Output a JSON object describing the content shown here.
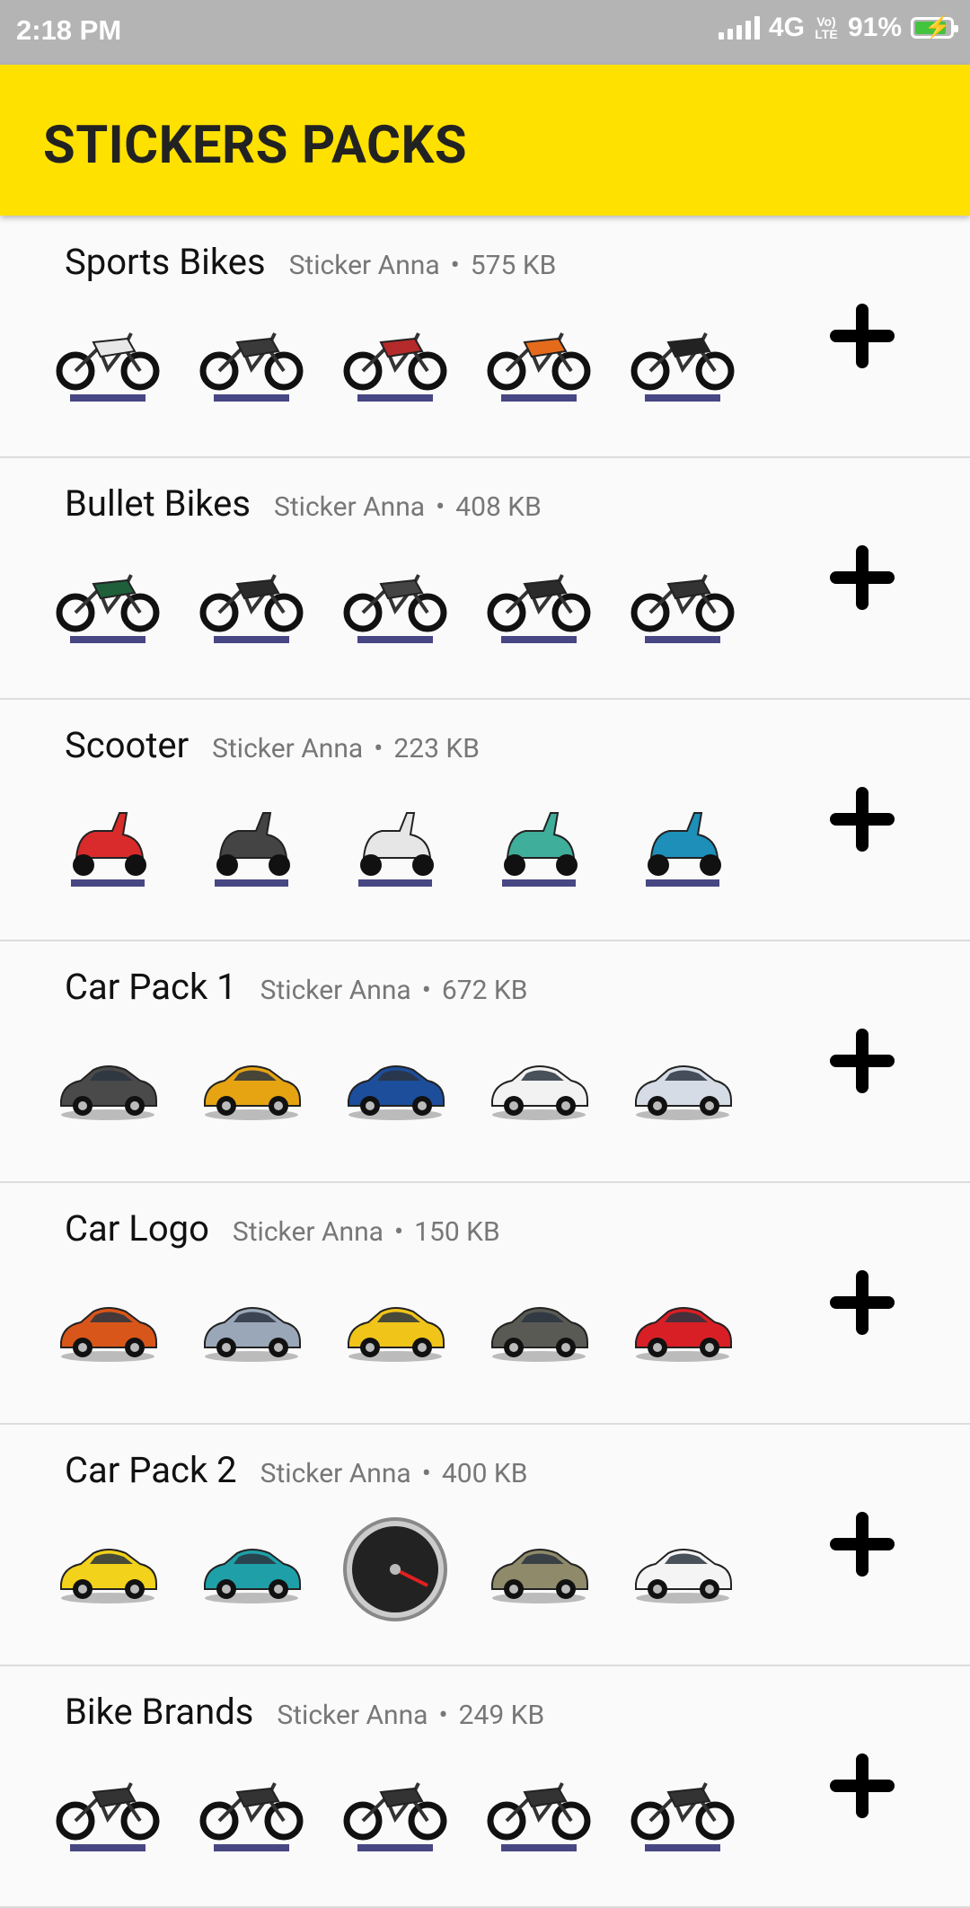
{
  "status": {
    "time": "2:18 PM",
    "network": "4G",
    "volte": "Vo)) LTE",
    "battery": "91%"
  },
  "app": {
    "title": "STICKERS PACKS"
  },
  "packs": [
    {
      "name": "Sports Bikes",
      "author": "Sticker Anna",
      "size": "575 KB",
      "kind": "bike",
      "colors": [
        "#e8e8e8",
        "#3a3a3a",
        "#b52a2a",
        "#e46b1c",
        "#222222"
      ]
    },
    {
      "name": "Bullet Bikes",
      "author": "Sticker Anna",
      "size": "408 KB",
      "kind": "bike",
      "colors": [
        "#1f5f3a",
        "#2a2a2a",
        "#444444",
        "#2b2b2b",
        "#333333"
      ]
    },
    {
      "name": "Scooter",
      "author": "Sticker Anna",
      "size": "223 KB",
      "kind": "scooter",
      "colors": [
        "#d92b2b",
        "#444444",
        "#e6e6e6",
        "#3fae9a",
        "#1d8fb8"
      ]
    },
    {
      "name": "Car Pack 1",
      "author": "Sticker Anna",
      "size": "672 KB",
      "kind": "car",
      "colors": [
        "#4a4a4a",
        "#e7a412",
        "#1c4e9c",
        "#f2f2f2",
        "#d6dce6"
      ]
    },
    {
      "name": "Car Logo",
      "author": "Sticker Anna",
      "size": "150 KB",
      "kind": "car",
      "colors": [
        "#d9561a",
        "#9aa7b8",
        "#f0c419",
        "#5a5a55",
        "#d91f26"
      ]
    },
    {
      "name": "Car Pack 2",
      "author": "Sticker Anna",
      "size": "400 KB",
      "kind": "mixed",
      "colors": [
        "#f2d21a",
        "#1fa0a8",
        "#444444",
        "#8f8a6a",
        "#f4f4f4"
      ]
    },
    {
      "name": "Bike Brands",
      "author": "Sticker Anna",
      "size": "249 KB",
      "kind": "bike",
      "colors": [
        "#333333",
        "#333333",
        "#333333",
        "#333333",
        "#333333"
      ]
    }
  ]
}
